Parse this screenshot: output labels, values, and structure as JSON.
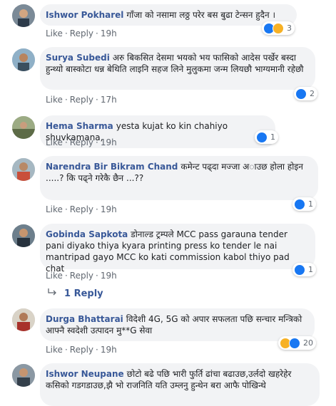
{
  "comments": [
    {
      "author": "Ishwor Pokharel",
      "text": "गाँजा को नसामा लठ्ठ परेर बस बुढा टेन्सन हुदैन ।",
      "like": "Like",
      "reply": "Reply",
      "time": "19h",
      "reaction_count": "3",
      "reaction_icons": [
        "like-icon",
        "haha-icon"
      ]
    },
    {
      "author": "Surya Subedi",
      "text": "अरु बिकसित देसमा भयको भय फासिको आदेस पर्खेर बस्दा हुन्थ्यो बास्कोटा धन्न बेथिति लाइनि सहज लिने मुलुकमा जन्म लियछौ भाग्यमानी रहेछौ",
      "like": "Like",
      "reply": "Reply",
      "time": "17h",
      "reaction_count": "2",
      "reaction_icons": [
        "like-icon"
      ]
    },
    {
      "author": "Hema Sharma",
      "text": "yesta kujat ko kin chahiyo shuvkamana,",
      "like": "Like",
      "reply": "Reply",
      "time": "19h",
      "reaction_count": "1",
      "reaction_icons": [
        "like-icon"
      ]
    },
    {
      "author": "Narendra Bir Bikram Chand",
      "text": "कमेन्ट पढ्दा मज्जा अाउछ होला होइन .....? कि पढ्ने गरेकै छैन ...??",
      "like": "Like",
      "reply": "Reply",
      "time": "19h",
      "reaction_count": "1",
      "reaction_icons": [
        "like-icon"
      ]
    },
    {
      "author": "Gobinda Sapkota",
      "text": "डोनाल्ड ट्रम्पले MCC pass garauna tender pani diyako thiya kyara printing press ko tender le nai mantripad gayo MCC ko kati commission kabol thiyo pad chat",
      "like": "Like",
      "reply": "Reply",
      "time": "19h",
      "reaction_count": "1",
      "reaction_icons": [
        "like-icon"
      ],
      "replies_label": "1 Reply"
    },
    {
      "author": "Durga Bhattarai",
      "text": "विदेशी 4G, 5G को अपार सफलता पछि सन्चार मन्त्रिको आफ्नै स्वदेशी उत्पादन मु**G सेवा",
      "like": "Like",
      "reply": "Reply",
      "time": "19h",
      "reaction_count": "20",
      "reaction_icons": [
        "haha-icon",
        "like-icon"
      ]
    },
    {
      "author": "Ishwor Neupane",
      "text": "छोटो बढे पछि भारी फुर्ति ढांचा बढाउछ,उर्लदो खहरेहेर कसिको गडगडाउछ,झै भो राजनिति यति उम्लनु हुन्थेन बरा आफै पोखिन्थे"
    }
  ],
  "colors": {
    "author": "#385898",
    "bubble": "#f2f3f5",
    "meta": "#606770",
    "like_reaction": "#1877f2",
    "haha_reaction": "#f7b125"
  }
}
